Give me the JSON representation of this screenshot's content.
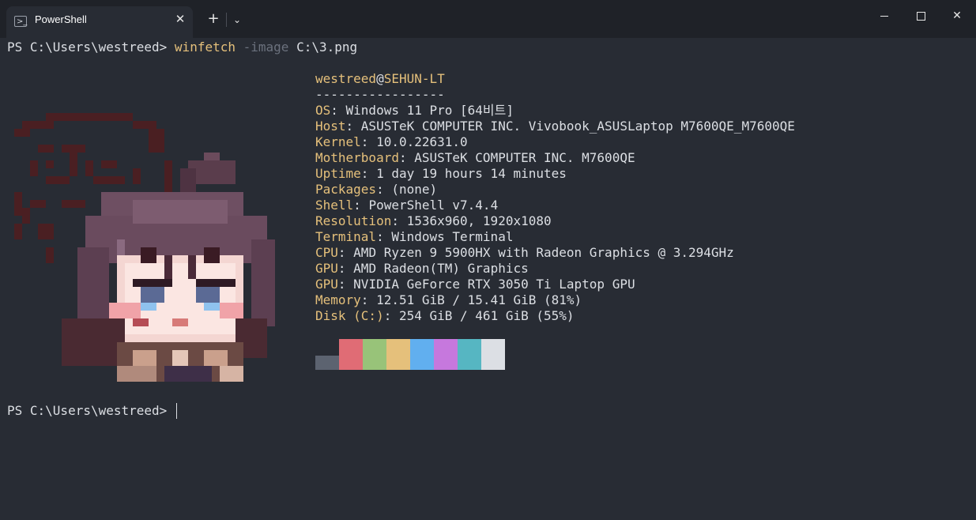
{
  "tab": {
    "title": "PowerShell",
    "icon": "powershell-icon",
    "close": "✕"
  },
  "titlebar": {
    "new_tab": "+",
    "dropdown": "⌄",
    "minimize": "minimize-icon",
    "maximize": "maximize-icon",
    "close": "✕"
  },
  "command": {
    "prompt": "PS C:\\Users\\westreed> ",
    "name": "winfetch",
    "param": "-image",
    "arg": "C:\\3.png"
  },
  "info": {
    "user": "westreed",
    "at": "@",
    "host": "SEHUN-LT",
    "separator": "-----------------",
    "rows": [
      {
        "key": "OS",
        "sep": ": ",
        "value": "Windows 11 Pro [64비트]"
      },
      {
        "key": "Host",
        "sep": ": ",
        "value": "ASUSTeK COMPUTER INC. Vivobook_ASUSLaptop M7600QE_M7600QE"
      },
      {
        "key": "Kernel",
        "sep": ": ",
        "value": "10.0.22631.0"
      },
      {
        "key": "Motherboard",
        "sep": ": ",
        "value": "ASUSTeK COMPUTER INC. M7600QE"
      },
      {
        "key": "Uptime",
        "sep": ": ",
        "value": "1 day 19 hours 14 minutes"
      },
      {
        "key": "Packages",
        "sep": ": ",
        "value": "(none)"
      },
      {
        "key": "Shell",
        "sep": ": ",
        "value": "PowerShell v7.4.4"
      },
      {
        "key": "Resolution",
        "sep": ": ",
        "value": "1536x960, 1920x1080"
      },
      {
        "key": "Terminal",
        "sep": ": ",
        "value": "Windows Terminal"
      },
      {
        "key": "CPU",
        "sep": ": ",
        "value": "AMD Ryzen 9 5900HX with Radeon Graphics @ 3.294GHz"
      },
      {
        "key": "GPU",
        "sep": ": ",
        "value": "AMD Radeon(TM) Graphics"
      },
      {
        "key": "GPU",
        "sep": ": ",
        "value": "NVIDIA GeForce RTX 3050 Ti Laptop GPU"
      },
      {
        "key": "Memory",
        "sep": ": ",
        "value": "12.51 GiB / 15.41 GiB (81%)"
      },
      {
        "key": "Disk (C:)",
        "sep": ": ",
        "value": "254 GiB / 461 GiB (55%)"
      }
    ],
    "palette": [
      "#5c6370",
      "#e06c75",
      "#98c379",
      "#e5c07b",
      "#61afef",
      "#c678dd",
      "#56b6c2",
      "#dcdfe4"
    ]
  },
  "prompt2": "PS C:\\Users\\westreed> ",
  "colors": {
    "background": "#282c34",
    "titlebar": "#1f2228",
    "accent": "#e5c07b",
    "param": "#6b717d"
  }
}
